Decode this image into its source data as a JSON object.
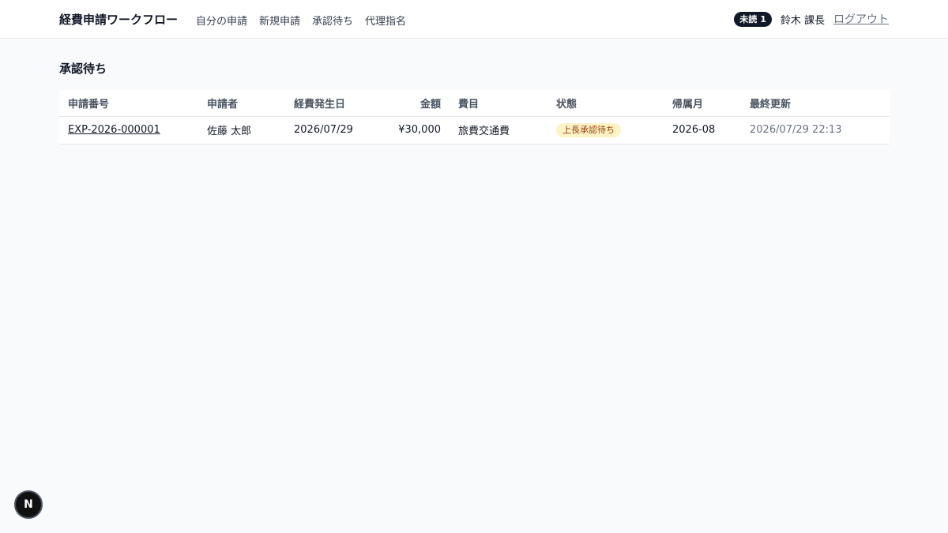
{
  "header": {
    "brand": "経費申請ワークフロー",
    "nav": [
      "自分の申請",
      "新規申請",
      "承認待ち",
      "代理指名"
    ],
    "unread_label": "未読",
    "unread_count": "1",
    "user": "鈴木 課長",
    "logout": "ログアウト"
  },
  "main": {
    "title": "承認待ち",
    "columns": [
      "申請番号",
      "申請者",
      "経費発生日",
      "金額",
      "費目",
      "状態",
      "帰属月",
      "最終更新"
    ],
    "rows": [
      {
        "id": "EXP-2026-000001",
        "applicant": "佐藤 太郎",
        "date": "2026/07/29",
        "amount": "¥30,000",
        "category": "旅費交通費",
        "status": "上長承認待ち",
        "month": "2026-08",
        "updated": "2026/07/29 22:13"
      }
    ]
  },
  "floating": {
    "label": "N"
  }
}
